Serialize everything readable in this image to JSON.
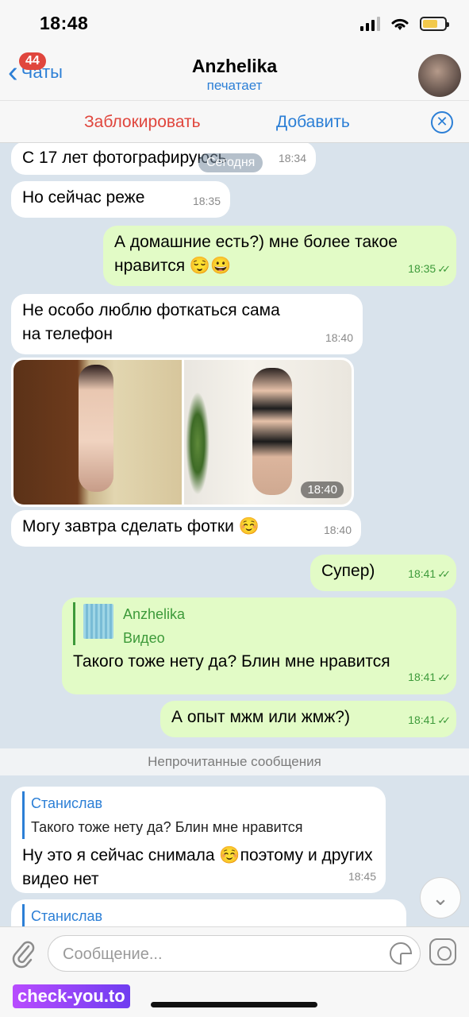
{
  "status_bar": {
    "time": "18:48"
  },
  "nav": {
    "back_label": "Чаты",
    "unread_count": "44",
    "title": "Anzhelika",
    "subtitle": "печатает"
  },
  "actions": {
    "block_label": "Заблокировать",
    "add_label": "Добавить"
  },
  "chat": {
    "date_pill": "Сегодня",
    "messages": [
      {
        "text": "С 17 лет фотографируюсь",
        "time": "18:34"
      },
      {
        "text": "Но сейчас реже",
        "time": "18:35"
      },
      {
        "text": "А домашние есть?) мне более такое нравится 😌😀",
        "time": "18:35"
      },
      {
        "text": "Не особо люблю фоткаться сама на телефон",
        "time": "18:40"
      },
      {
        "time": "18:40"
      },
      {
        "text": "Могу завтра сделать фотки ☺️",
        "time": "18:40"
      },
      {
        "text": "Супер)",
        "time": "18:41"
      },
      {
        "reply_name": "Anzhelika",
        "reply_text": "Видео",
        "text": "Такого тоже нету да? Блин мне нравится",
        "time": "18:41"
      },
      {
        "text": "А опыт мжм или жмж?)",
        "time": "18:41"
      },
      {
        "reply_name": "Станислав",
        "reply_text": "Такого тоже нету да? Блин мне нравится",
        "text": "Ну это я сейчас снимала ☺️поэтому и других видео нет",
        "time": "18:45"
      },
      {
        "reply_name": "Станислав"
      }
    ],
    "unread_divider": "Непрочитанные сообщения"
  },
  "input": {
    "placeholder": "Сообщение..."
  },
  "watermark": "check-you.to"
}
